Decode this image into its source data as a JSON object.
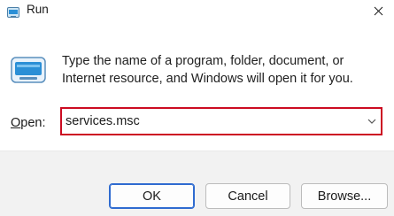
{
  "window": {
    "title": "Run",
    "close_icon": "close-icon",
    "app_icon": "run-icon"
  },
  "description": "Type the name of a program, folder, document, or Internet resource, and Windows will open it for you.",
  "open_field": {
    "label_accel": "O",
    "label_rest": "pen:",
    "value": "services.msc",
    "highlight_color": "#cc0c22"
  },
  "buttons": {
    "ok": "OK",
    "cancel": "Cancel",
    "browse": "Browse..."
  }
}
